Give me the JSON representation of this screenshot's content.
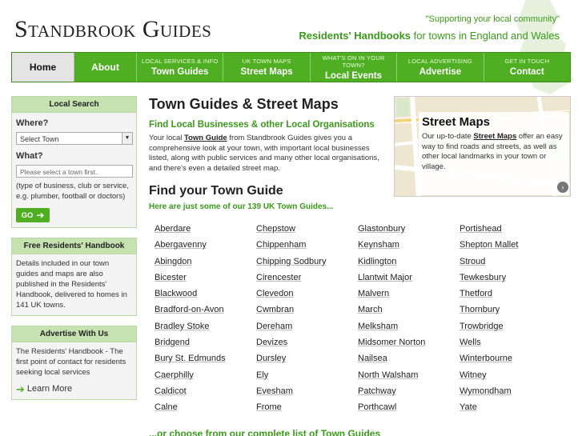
{
  "header": {
    "logo": "Standbrook Guides",
    "tagline": "\"Supporting your local community\"",
    "subtag_bold": "Residents' Handbooks",
    "subtag_rest": " for towns in England and Wales"
  },
  "nav": {
    "home": "Home",
    "about": "About",
    "items": [
      {
        "small": "LOCAL SERVICES & INFO",
        "big": "Town Guides"
      },
      {
        "small": "UK TOWN MAPS",
        "big": "Street Maps"
      },
      {
        "small": "WHAT'S ON IN YOUR TOWN?",
        "big": "Local Events"
      },
      {
        "small": "LOCAL ADVERTISING",
        "big": "Advertise"
      },
      {
        "small": "GET IN TOUCH",
        "big": "Contact"
      }
    ]
  },
  "sidebar": {
    "search": {
      "title": "Local Search",
      "where_label": "Where?",
      "select_value": "Select Town",
      "what_label": "What?",
      "input_placeholder": "Please select a town first.",
      "hint": "(type of business, club or service, e.g. plumber, football or doctors)",
      "go": "GO"
    },
    "handbook": {
      "title": "Free Residents' Handbook",
      "text": "Details included in our town guides and maps are also published in the Residents' Handbook, delivered to homes in 141 UK towns."
    },
    "advertise": {
      "title": "Advertise With Us",
      "text": "The Residents' Handbook - The first point of contact for residents seeking local services",
      "link": "Learn More"
    }
  },
  "main": {
    "title": "Town Guides & Street Maps",
    "subtitle": "Find Local Businesses & other Local Organisations",
    "intro_pre": "Your local ",
    "intro_link": "Town Guide",
    "intro_post": " from Standbrook Guides gives you a comprehensive look at your town, with important local businesses listed, along with public services and many other local organisations, and there's even a detailed street map.",
    "find_title": "Find your Town Guide",
    "find_sub": "Here are just some of our 139 UK Town Guides...",
    "more_pre": "...or choose from our ",
    "more_link": "complete list of Town Guides"
  },
  "streetmap": {
    "title": "Street Maps",
    "pre": "Our up-to-date ",
    "link": "Street Maps",
    "post": " offer an easy way to find roads and streets, as well as other local landmarks in your town or village."
  },
  "towns": [
    [
      "Aberdare",
      "Abergavenny",
      "Abingdon",
      "Bicester",
      "Blackwood",
      "Bradford-on-Avon",
      "Bradley Stoke",
      "Bridgend",
      "Bury St. Edmunds",
      "Caerphilly",
      "Caldicot",
      "Calne"
    ],
    [
      "Chepstow",
      "Chippenham",
      "Chipping Sodbury",
      "Cirencester",
      "Clevedon",
      "Cwmbran",
      "Dereham",
      "Devizes",
      "Dursley",
      "Ely",
      "Evesham",
      "Frome"
    ],
    [
      "Glastonbury",
      "Keynsham",
      "Kidlington",
      "Llantwit Major",
      "Malvern",
      "March",
      "Melksham",
      "Midsomer Norton",
      "Nailsea",
      "North Walsham",
      "Patchway",
      "Porthcawl"
    ],
    [
      "Portishead",
      "Shepton Mallet",
      "Stroud",
      "Tewkesbury",
      "Thetford",
      "Thornbury",
      "Trowbridge",
      "Wells",
      "Winterbourne",
      "Witney",
      "Wymondham",
      "Yate"
    ]
  ]
}
